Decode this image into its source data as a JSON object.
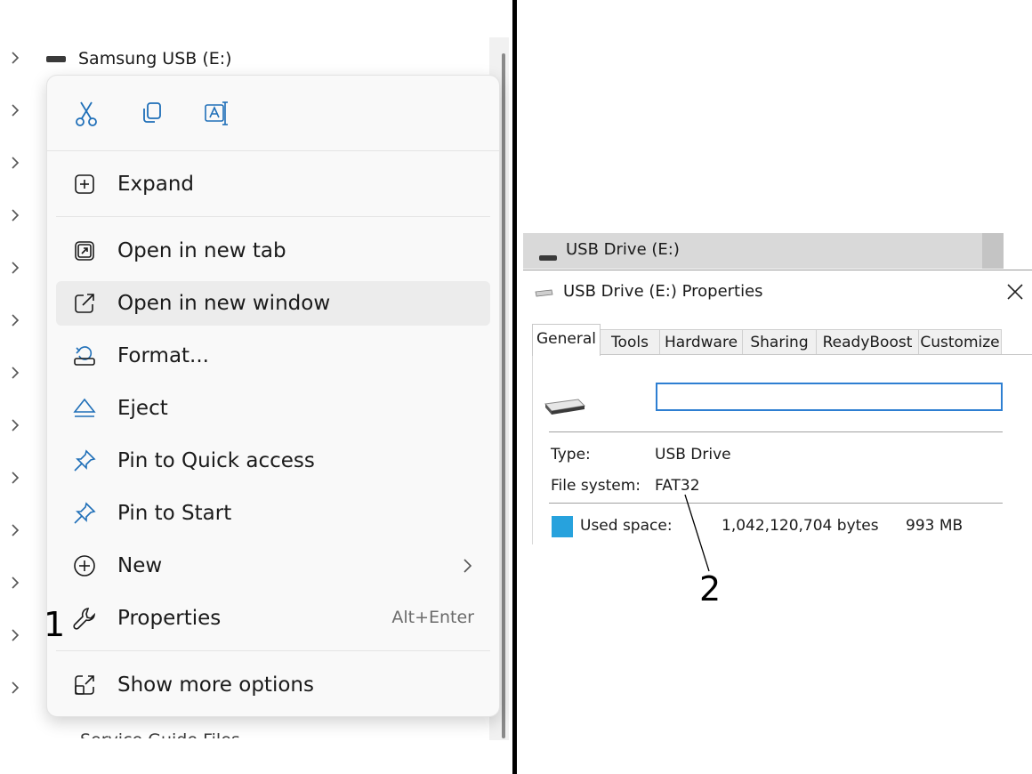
{
  "tree": {
    "drive_label": "Samsung USB (E:)",
    "cut_off_label": "Service Guide Files"
  },
  "context_menu": {
    "quick_actions": [
      {
        "name": "cut-icon"
      },
      {
        "name": "copy-icon"
      },
      {
        "name": "rename-icon"
      }
    ],
    "items": [
      {
        "label": "Expand",
        "icon": "expand-icon"
      },
      {
        "label": "Open in new tab",
        "icon": "open-new-tab-icon"
      },
      {
        "label": "Open in new window",
        "icon": "open-new-window-icon",
        "highlighted": true
      },
      {
        "label": "Format...",
        "icon": "format-icon"
      },
      {
        "label": "Eject",
        "icon": "eject-icon"
      },
      {
        "label": "Pin to Quick access",
        "icon": "pin-icon"
      },
      {
        "label": "Pin to Start",
        "icon": "pin-icon"
      },
      {
        "label": "New",
        "icon": "new-icon",
        "has_submenu": true
      },
      {
        "label": "Properties",
        "icon": "wrench-icon",
        "shortcut": "Alt+Enter"
      },
      {
        "label": "Show more options",
        "icon": "show-more-icon"
      }
    ]
  },
  "callouts": {
    "one": "1",
    "two": "2"
  },
  "explorer_row": {
    "label": "USB Drive (E:)"
  },
  "properties_dialog": {
    "title": "USB Drive (E:) Properties",
    "tabs": [
      "General",
      "Tools",
      "Hardware",
      "Sharing",
      "ReadyBoost",
      "Customize"
    ],
    "active_tab": "General",
    "name_value": "",
    "type_label": "Type:",
    "type_value": "USB Drive",
    "fs_label": "File system:",
    "fs_value": "FAT32",
    "used_label": "Used space:",
    "used_bytes": "1,042,120,704 bytes",
    "used_size": "993 MB",
    "used_color": "#27a2dd",
    "input_border_color": "#2e7fd2"
  }
}
